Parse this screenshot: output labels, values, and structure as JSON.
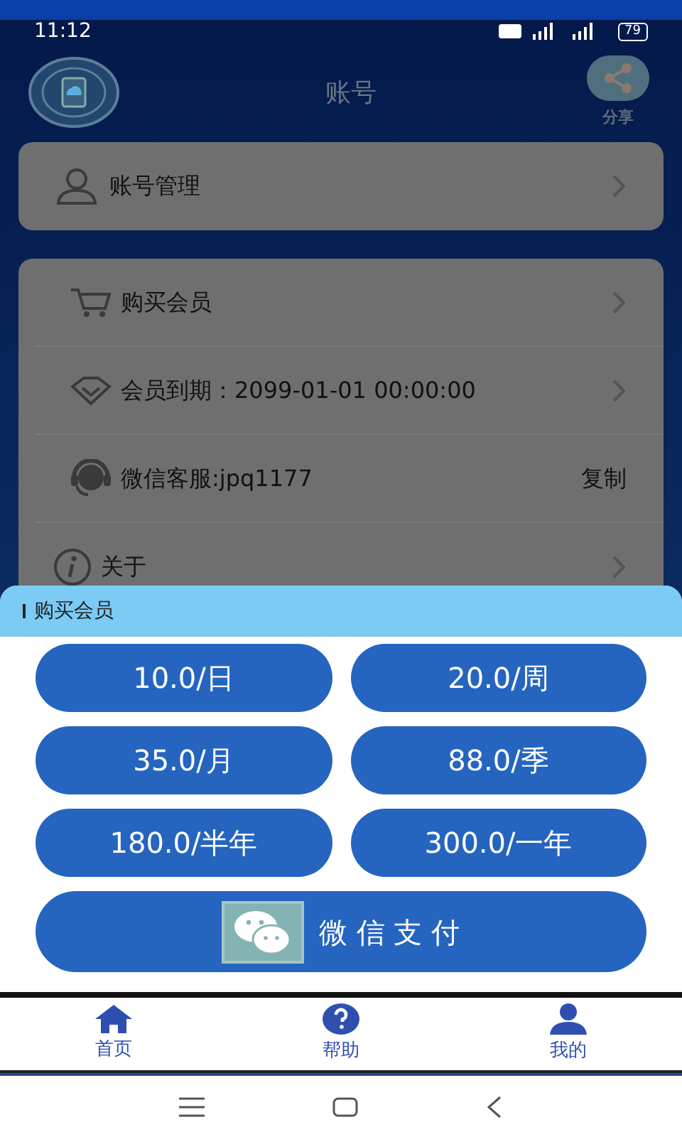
{
  "status_bar": {
    "time": "11:12",
    "battery": "79"
  },
  "header": {
    "title": "账号",
    "share_label": "分享"
  },
  "account_card": {
    "label": "账号管理"
  },
  "menu": [
    {
      "kind": "cart",
      "label": "购买会员",
      "chevron": true
    },
    {
      "kind": "diamond",
      "label": "会员到期：2099-01-01 00:00:00",
      "chevron": true
    },
    {
      "kind": "headset",
      "label": "微信客服:jpq1177",
      "chevron": false,
      "action_text": "复制"
    },
    {
      "kind": "info",
      "label": "关于",
      "chevron": true
    }
  ],
  "sheet": {
    "title": "购买会员",
    "options": [
      "10.0/日",
      "20.0/周",
      "35.0/月",
      "88.0/季",
      "180.0/半年",
      "300.0/一年"
    ],
    "pay_button": "微 信 支 付"
  },
  "bottom_nav": [
    {
      "kind": "home",
      "label": "首页"
    },
    {
      "kind": "help",
      "label": "帮助"
    },
    {
      "kind": "user",
      "label": "我的"
    }
  ]
}
